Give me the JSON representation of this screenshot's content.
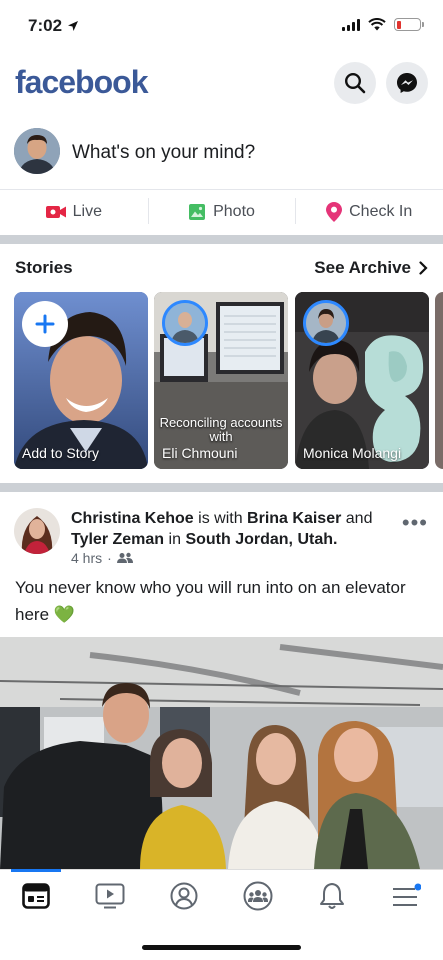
{
  "status_bar": {
    "time": "7:02"
  },
  "header": {
    "logo": "facebook",
    "icons": [
      "search-icon",
      "messenger-icon"
    ]
  },
  "composer": {
    "placeholder": "What's on your mind?"
  },
  "actions": [
    {
      "label": "Live",
      "icon": "live-video-icon",
      "color": "#e42645"
    },
    {
      "label": "Photo",
      "icon": "photo-icon",
      "color": "#44bd63"
    },
    {
      "label": "Check In",
      "icon": "location-pin-icon",
      "color": "#e53478"
    }
  ],
  "stories": {
    "title": "Stories",
    "see_archive": "See Archive",
    "items": [
      {
        "label": "Add to Story"
      },
      {
        "label": "Eli Chmouni",
        "caption": "Reconciling accounts with"
      },
      {
        "label": "Monica Molangi"
      }
    ]
  },
  "post": {
    "author": "Christina Kehoe",
    "with_text": "is with",
    "tagged_1": "Brina Kaiser",
    "and_text": "and",
    "tagged_2": "Tyler Zeman",
    "in_text": "in",
    "location": "South Jordan, Utah.",
    "time": "4 hrs",
    "audience_icon": "friends-icon",
    "text": "You never know who you will run into on an elevator here 💚"
  },
  "bottom_nav": {
    "items": [
      "news-feed-icon",
      "watch-icon",
      "profile-icon",
      "groups-icon",
      "notifications-icon",
      "menu-icon"
    ],
    "active_color": "#1877f2"
  }
}
